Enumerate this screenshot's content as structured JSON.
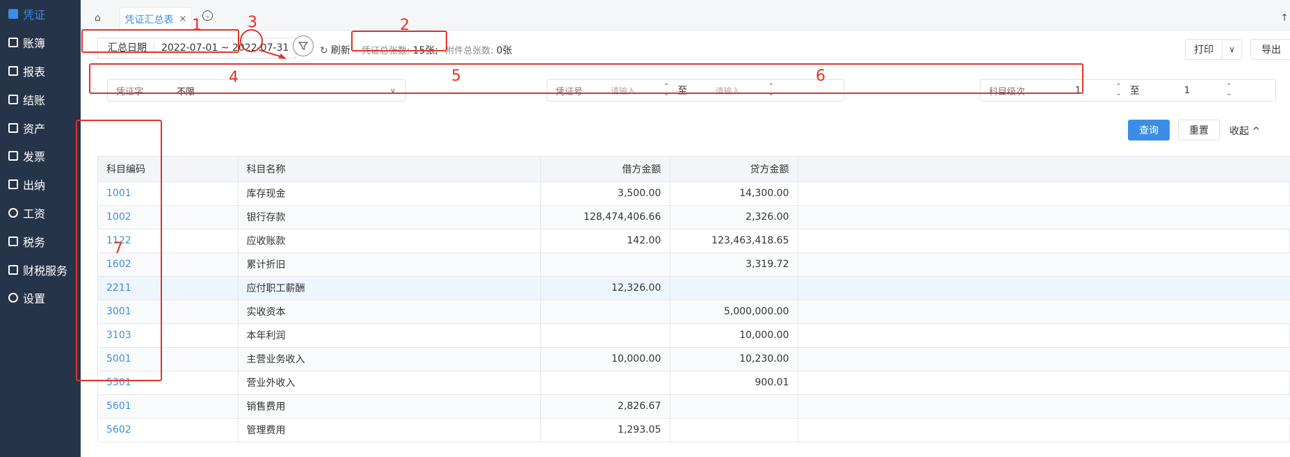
{
  "sidebar": {
    "items": [
      {
        "label": "凭证",
        "icon": "voucher-icon"
      },
      {
        "label": "账簿",
        "icon": "ledger-icon"
      },
      {
        "label": "报表",
        "icon": "report-icon"
      },
      {
        "label": "结账",
        "icon": "closing-icon"
      },
      {
        "label": "资产",
        "icon": "asset-icon"
      },
      {
        "label": "发票",
        "icon": "invoice-icon"
      },
      {
        "label": "出纳",
        "icon": "cashier-icon"
      },
      {
        "label": "工资",
        "icon": "salary-icon"
      },
      {
        "label": "税务",
        "icon": "tax-icon"
      },
      {
        "label": "财税服务",
        "icon": "tax-service-icon"
      },
      {
        "label": "设置",
        "icon": "settings-icon"
      }
    ],
    "active_color": "#3a8ee6",
    "background": "#26344a"
  },
  "tabs": {
    "active_tab": "凭证汇总表",
    "close_glyph": "×",
    "home_glyph": "⌂",
    "more_glyph": "⌄",
    "scroll_up_glyph": "↑"
  },
  "toolbar": {
    "date_label": "汇总日期",
    "date_range": "2022-07-01 ~ 2022-07-31",
    "filter_glyph": "⚲",
    "refresh_label": "刷新",
    "voucher_total_label": "凭证总张数:",
    "voucher_total_value": "15张;",
    "attachment_total_label": "附件总张数:",
    "attachment_total_value": "0张",
    "print_label": "打印",
    "export_label": "导出"
  },
  "filters": {
    "voucher_word_label": "凭证字",
    "voucher_word_value": "不限",
    "voucher_no_label": "凭证号",
    "voucher_no_from_placeholder": "请输入",
    "voucher_no_to_label": "至",
    "voucher_no_to_placeholder": "请输入",
    "subject_level_label": "科目级次",
    "subject_level_from": "1",
    "subject_level_to_label": "至",
    "subject_level_to": "1"
  },
  "actions": {
    "query_label": "查询",
    "reset_label": "重置",
    "collapse_label": "收起 ^"
  },
  "table": {
    "headers": [
      "科目编码",
      "科目名称",
      "借方金额",
      "贷方金额"
    ],
    "rows": [
      {
        "code": "1001",
        "name": "库存现金",
        "debit": "3,500.00",
        "credit": "14,300.00"
      },
      {
        "code": "1002",
        "name": "银行存款",
        "debit": "128,474,406.66",
        "credit": "2,326.00"
      },
      {
        "code": "1122",
        "name": "应收账款",
        "debit": "142.00",
        "credit": "123,463,418.65"
      },
      {
        "code": "1602",
        "name": "累计折旧",
        "debit": "",
        "credit": "3,319.72"
      },
      {
        "code": "2211",
        "name": "应付职工薪酬",
        "debit": "12,326.00",
        "credit": ""
      },
      {
        "code": "3001",
        "name": "实收资本",
        "debit": "",
        "credit": "5,000,000.00"
      },
      {
        "code": "3103",
        "name": "本年利润",
        "debit": "",
        "credit": "10,000.00"
      },
      {
        "code": "5001",
        "name": "主营业务收入",
        "debit": "10,000.00",
        "credit": "10,230.00"
      },
      {
        "code": "5301",
        "name": "营业外收入",
        "debit": "",
        "credit": "900.01"
      },
      {
        "code": "5601",
        "name": "销售费用",
        "debit": "2,826.67",
        "credit": ""
      },
      {
        "code": "5602",
        "name": "管理费用",
        "debit": "1,293.05",
        "credit": ""
      }
    ],
    "highlighted_row_code": "2211"
  },
  "annotations": {
    "labels": [
      "1",
      "2",
      "3",
      "4",
      "5",
      "6",
      "7"
    ],
    "color": "#e0332a"
  }
}
